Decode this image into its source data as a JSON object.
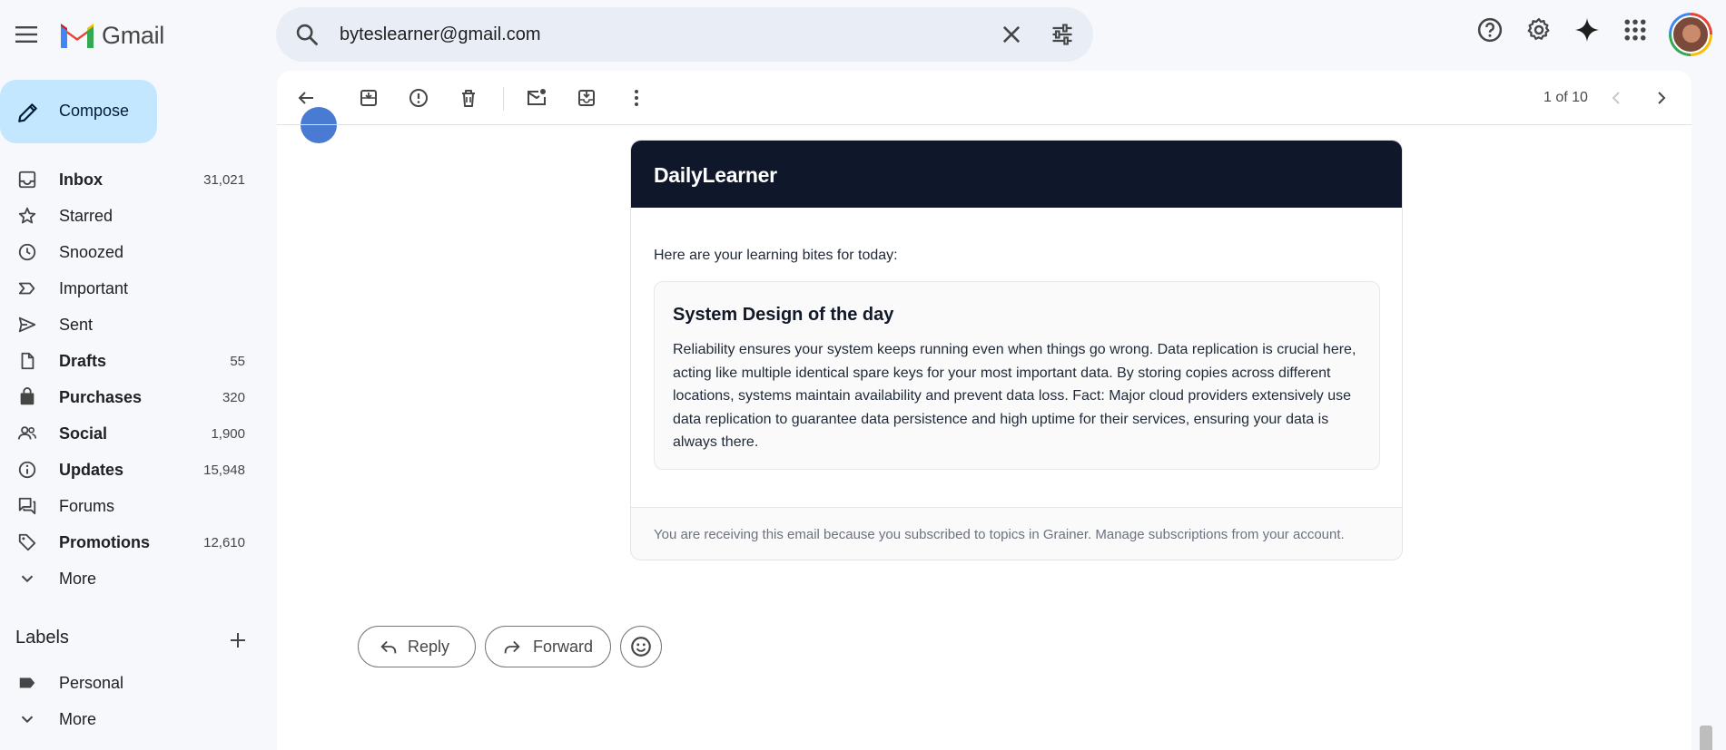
{
  "app": {
    "name": "Gmail",
    "search": {
      "value": "byteslearner@gmail.com"
    }
  },
  "header": {
    "icons": [
      "help-icon",
      "settings-icon",
      "gemini-sparkle-icon",
      "apps-grid-icon"
    ]
  },
  "sidebar": {
    "compose_label": "Compose",
    "items": [
      {
        "label": "Inbox",
        "count": "31,021",
        "bold": true,
        "icon": "inbox-icon"
      },
      {
        "label": "Starred",
        "count": "",
        "bold": false,
        "icon": "star-icon"
      },
      {
        "label": "Snoozed",
        "count": "",
        "bold": false,
        "icon": "clock-icon"
      },
      {
        "label": "Important",
        "count": "",
        "bold": false,
        "icon": "important-icon"
      },
      {
        "label": "Sent",
        "count": "",
        "bold": false,
        "icon": "send-icon"
      },
      {
        "label": "Drafts",
        "count": "55",
        "bold": true,
        "icon": "draft-icon"
      },
      {
        "label": "Purchases",
        "count": "320",
        "bold": true,
        "icon": "shopping-bag-icon"
      },
      {
        "label": "Social",
        "count": "1,900",
        "bold": true,
        "icon": "people-icon"
      },
      {
        "label": "Updates",
        "count": "15,948",
        "bold": true,
        "icon": "info-icon"
      },
      {
        "label": "Forums",
        "count": "",
        "bold": false,
        "icon": "forum-icon"
      },
      {
        "label": "Promotions",
        "count": "12,610",
        "bold": true,
        "icon": "tag-icon"
      },
      {
        "label": "More",
        "count": "",
        "bold": false,
        "icon": "chevron-down-icon"
      }
    ],
    "labels_title": "Labels",
    "labels": [
      {
        "label": "Personal",
        "icon": "label-icon"
      },
      {
        "label": "More",
        "icon": "chevron-down-icon"
      }
    ]
  },
  "toolbar": {
    "pager": "1 of 10"
  },
  "email": {
    "brand": "DailyLearner",
    "intro": "Here are your learning bites for today:",
    "topic_title": "System Design of the day",
    "topic_body": "Reliability ensures your system keeps running even when things go wrong. Data replication is crucial here, acting like multiple identical spare keys for your most important data. By storing copies across different locations, systems maintain availability and prevent data loss. Fact: Major cloud providers extensively use data replication to guarantee data persistence and high uptime for their services, ensuring your data is always there.",
    "footer": "You are receiving this email because you subscribed to topics in Grainer. Manage subscriptions from your account."
  },
  "actions": {
    "reply": "Reply",
    "forward": "Forward"
  },
  "colors": {
    "compose_bg": "#c2e7ff",
    "search_bg": "#e9eef6",
    "brand_header": "#0f172a",
    "app_bg": "#f6f8fc"
  }
}
